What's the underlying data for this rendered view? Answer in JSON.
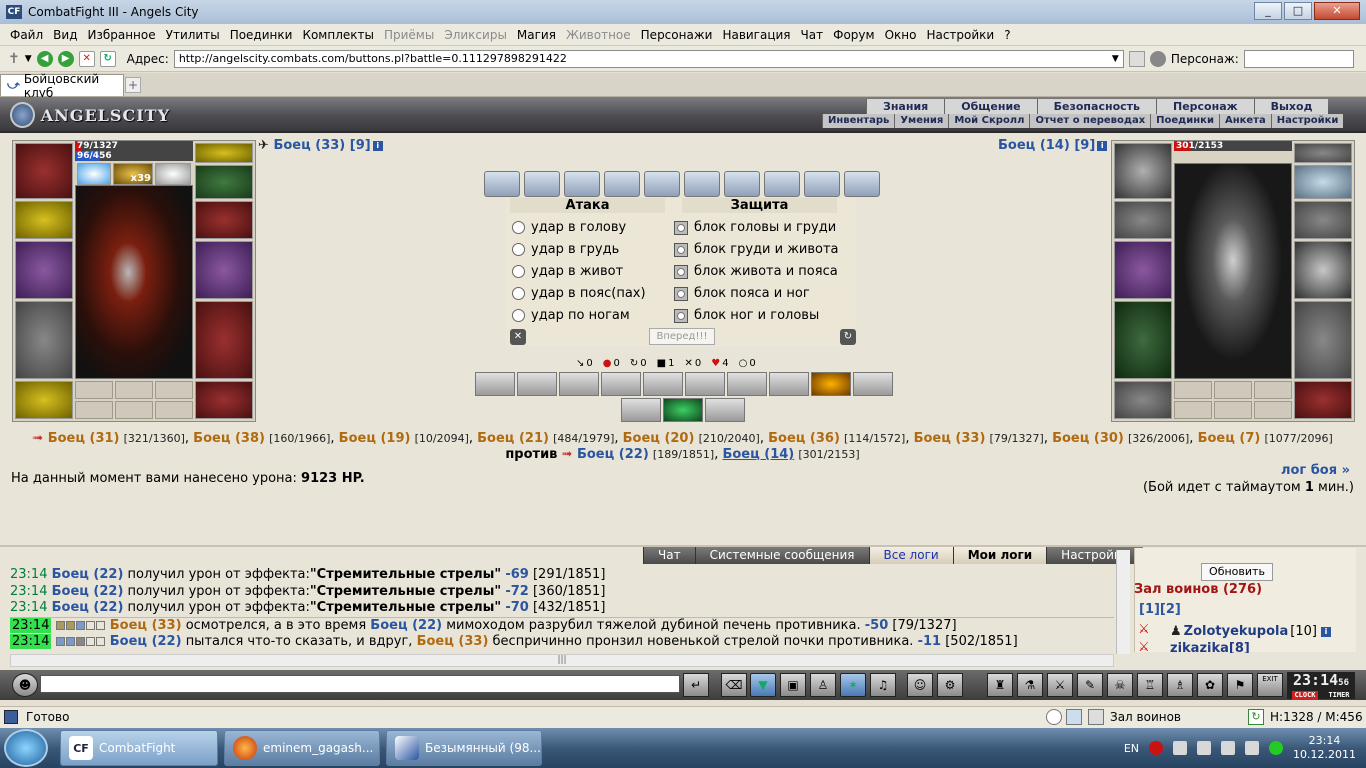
{
  "window": {
    "title": "CombatFight III - Angels City",
    "min": "_",
    "max": "□",
    "close": "✕"
  },
  "menu": [
    "Файл",
    "Вид",
    "Избранное",
    "Утилиты",
    "Поединки",
    "Комплекты",
    "Приёмы",
    "Эликсиры",
    "Магия",
    "Животное",
    "Персонажи",
    "Навигация",
    "Чат",
    "Форум",
    "Окно",
    "Настройки",
    "?"
  ],
  "menu_disabled": [
    "Приёмы",
    "Эликсиры",
    "Животное"
  ],
  "address": {
    "label": "Адрес:",
    "url": "http://angelscity.combats.com/buttons.pl?battle=0.111297898291422",
    "persona_label": "Персонаж:"
  },
  "tab": {
    "label": "Бойцовский клуб",
    "add": "+"
  },
  "game_header": {
    "logo": "ANGELSCITY",
    "nav1": [
      "Знания",
      "Общение",
      "Безопасность",
      "Персонаж",
      "Выход"
    ],
    "nav2": [
      "Инвентарь",
      "Умения",
      "Мой Скролл",
      "Отчет о переводах",
      "Поединки",
      "Анкета",
      "Настройки"
    ]
  },
  "left_fighter": {
    "name": "Боец (33)",
    "level": "[9]",
    "hp": "79/1327",
    "mana": "96/456",
    "badge": "x39"
  },
  "right_fighter": {
    "name": "Боец (14)",
    "level": "[9]",
    "hp": "301/2153"
  },
  "battle": {
    "attack_header": "Атака",
    "defense_header": "Защита",
    "attack": [
      "удар в голову",
      "удар в грудь",
      "удар в живот",
      "удар в пояс(пах)",
      "удар по ногам"
    ],
    "defense": [
      "блок головы и груди",
      "блок груди и живота",
      "блок живота и пояса",
      "блок пояса и ног",
      "блок ног и головы"
    ],
    "forward": "Вперед!!!",
    "stats": [
      "0",
      "0",
      "0",
      "1",
      "0",
      "4",
      "0"
    ]
  },
  "teams": {
    "team1": [
      {
        "name": "Боец (31)",
        "hp": "[321/1360]"
      },
      {
        "name": "Боец (38)",
        "hp": "[160/1966]"
      },
      {
        "name": "Боец (19)",
        "hp": "[10/2094]"
      },
      {
        "name": "Боец (21)",
        "hp": "[484/1979]"
      },
      {
        "name": "Боец (20)",
        "hp": "[210/2040]"
      },
      {
        "name": "Боец (36)",
        "hp": "[114/1572]"
      },
      {
        "name": "Боец (33)",
        "hp": "[79/1327]"
      },
      {
        "name": "Боец (30)",
        "hp": "[326/2006]"
      },
      {
        "name": "Боец (7)",
        "hp": "[1077/2096]"
      }
    ],
    "versus": "против",
    "team2": [
      {
        "name": "Боец (22)",
        "hp": "[189/1851]"
      },
      {
        "name": "Боец (14)",
        "hp": "[301/2153]"
      }
    ]
  },
  "damage": {
    "text": "На данный момент вами нанесено урона:",
    "value": "9123 HP."
  },
  "log_link": "лог боя »",
  "timeout": {
    "prefix": "(Бой идет с таймаутом",
    "value": "1",
    "suffix": "мин.)"
  },
  "chat_tabs": [
    "Чат",
    "Системные сообщения",
    "Все логи",
    "Мои логи",
    "Настройки"
  ],
  "chat": [
    {
      "time": "23:14",
      "actor": "Боец (22)",
      "text": "получил урон от эффекта:",
      "bold": "\"Стремительные стрелы\"",
      "val": "-69",
      "hp": "[291/1851]"
    },
    {
      "time": "23:14",
      "actor": "Боец (22)",
      "text": "получил урон от эффекта:",
      "bold": "\"Стремительные стрелы\"",
      "val": "-72",
      "hp": "[360/1851]"
    },
    {
      "time": "23:14",
      "actor": "Боец (22)",
      "text": "получил урон от эффекта:",
      "bold": "\"Стремительные стрелы\"",
      "val": "-70",
      "hp": "[432/1851]"
    },
    {
      "time": "23:14",
      "actor": "Боец (33)",
      "text": "осмотрелся, а в это время",
      "target": "Боец (22)",
      "text2": "мимоходом разрубил тяжелой дубиной печень противника.",
      "val": "-50",
      "hp": "[79/1327]"
    },
    {
      "time": "23:14",
      "actor": "Боец (22)",
      "text": "пытался что-то сказать, и вдруг,",
      "target": "Боец (33)",
      "text2": "беспричинно пронзил новенькой стрелой почки противника.",
      "val": "-11",
      "hp": "[502/1851]"
    }
  ],
  "side": {
    "refresh": "Обновить",
    "hall": "Зал воинов (276)",
    "pages": "[1][2]",
    "player": "Zolotyekupola",
    "player_level": "[10]",
    "player2": "zikazika[8]"
  },
  "clock": {
    "time": "23:14",
    "sec": "56",
    "l1": "CLOCK",
    "l2": "TIMER",
    "exit": "EXIT"
  },
  "status": {
    "left": "Готово",
    "room": "Зал воинов",
    "coords": "H:1328 / M:456"
  },
  "taskbar": {
    "items": [
      "CombatFight",
      "eminem_gagash...",
      "Безымянный (98..."
    ],
    "lang": "EN",
    "time": "23:14",
    "date": "10.12.2011"
  },
  "colors": {
    "accent_blue": "#2a55a0",
    "name_orange": "#b06a10",
    "hall_red": "#a11515",
    "log_green": "#007d3b"
  }
}
